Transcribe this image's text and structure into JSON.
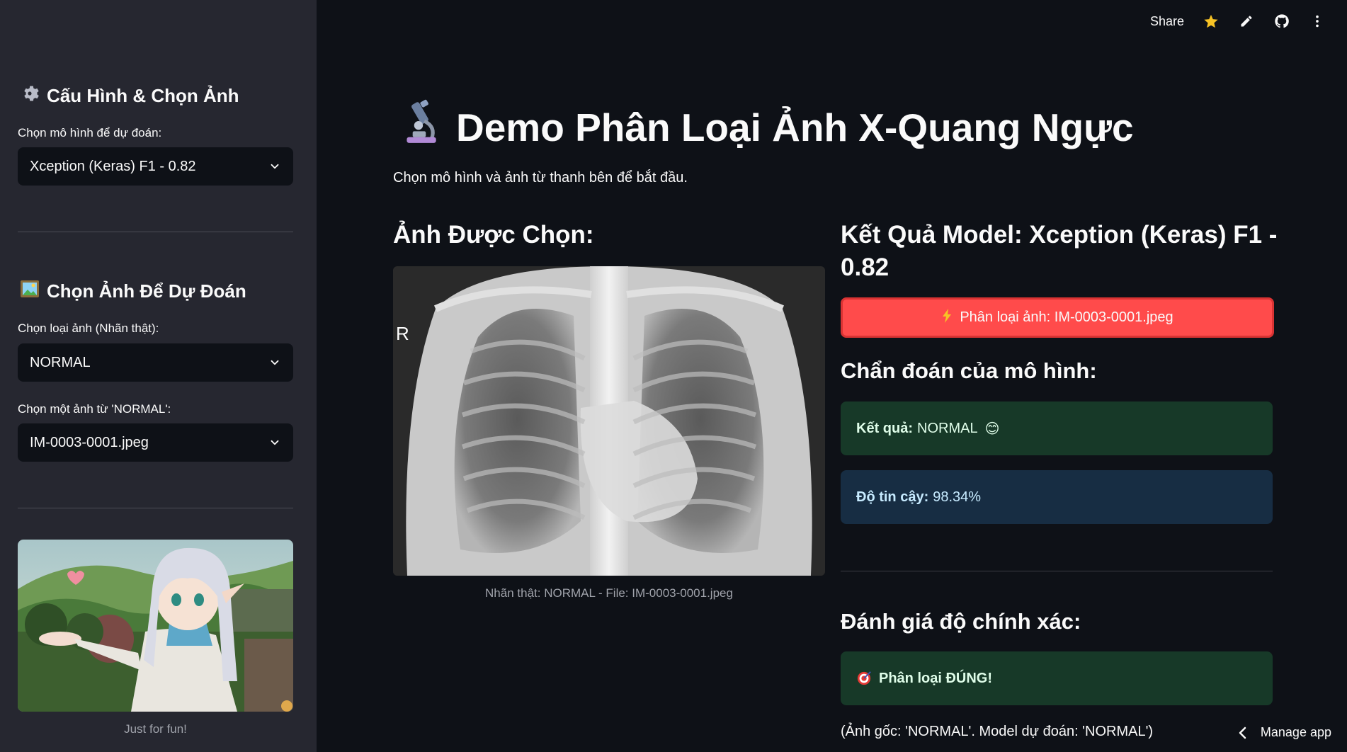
{
  "sidebar": {
    "config_heading": "Cấu Hình & Chọn Ảnh",
    "config_icon": "gear-icon",
    "model_label": "Chọn mô hình để dự đoán:",
    "model_value": "Xception (Keras) F1 - 0.82",
    "image_heading": "Chọn Ảnh Để Dự Đoán",
    "image_icon": "framed-picture-icon",
    "class_label": "Chọn loại ảnh (Nhãn thật):",
    "class_value": "NORMAL",
    "file_label": "Chọn một ảnh từ 'NORMAL':",
    "file_value": "IM-0003-0001.jpeg",
    "fun_caption": "Just for fun!"
  },
  "toolbar": {
    "share_label": "Share",
    "icons": [
      "star-icon",
      "pencil-icon",
      "github-icon",
      "more-vertical-icon"
    ]
  },
  "main": {
    "title": "Demo Phân Loại Ảnh X-Quang Ngực",
    "title_icon": "microscope-icon",
    "subtitle": "Chọn mô hình và ảnh từ thanh bên để bắt đầu.",
    "selected_heading": "Ảnh Được Chọn:",
    "image_caption": "Nhãn thật: NORMAL - File: IM-0003-0001.jpeg",
    "xray_marker": "R",
    "result_heading_line1": "Kết Quả Model: Xception (Keras) F1 -",
    "result_heading_line2": "0.82",
    "classify_button": "Phân loại ảnh: IM-0003-0001.jpeg",
    "diagnosis_heading": "Chẩn đoán của mô hình:",
    "result_label": "Kết quả:",
    "result_value": "NORMAL",
    "result_emoji": "😊",
    "confidence_label": "Độ tin cậy:",
    "confidence_value": "98.34%",
    "accuracy_heading": "Đánh giá độ chính xác:",
    "accuracy_result": "Phân loại ĐÚNG!",
    "footnote": "(Ảnh gốc: 'NORMAL'. Model dự đoán: 'NORMAL')"
  },
  "manage_app": "Manage app",
  "colors": {
    "sidebar_bg": "#262730",
    "main_bg": "#0e1117",
    "primary_red": "#ff4b4b",
    "success_bg": "#173928",
    "info_bg": "#172d43"
  }
}
